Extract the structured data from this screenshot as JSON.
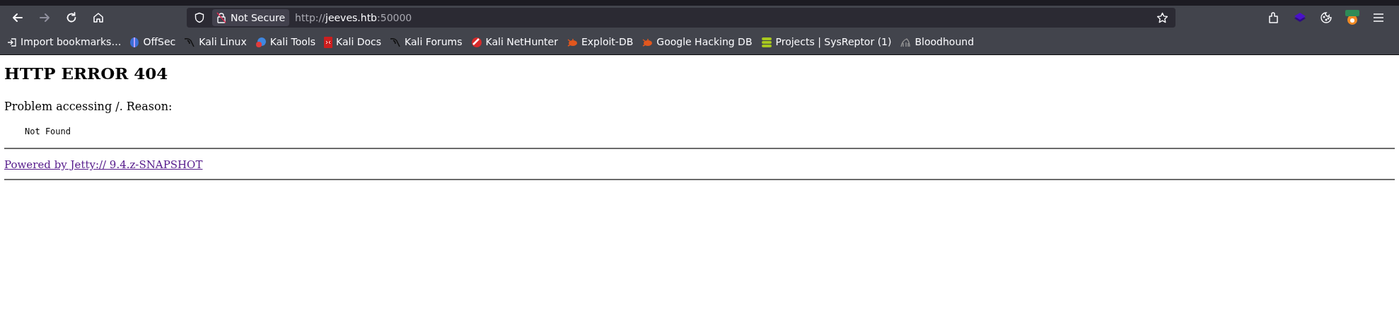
{
  "toolbar": {
    "back": {
      "disabled": false
    },
    "forward": {
      "disabled": true
    },
    "security_label": "Not Secure",
    "url": {
      "scheme": "http://",
      "host": "jeeves.htb",
      "port": ":50000"
    }
  },
  "bookmarks": [
    {
      "label": "Import bookmarks…"
    },
    {
      "label": "OffSec"
    },
    {
      "label": "Kali Linux"
    },
    {
      "label": "Kali Tools"
    },
    {
      "label": "Kali Docs"
    },
    {
      "label": "Kali Forums"
    },
    {
      "label": "Kali NetHunter"
    },
    {
      "label": "Exploit-DB"
    },
    {
      "label": "Google Hacking DB"
    },
    {
      "label": "Projects | SysReptor (1)"
    },
    {
      "label": "Bloodhound"
    }
  ],
  "page": {
    "heading": "HTTP ERROR 404",
    "message": "Problem accessing /. Reason:",
    "reason": "Not Found",
    "footer_link": "Powered by Jetty:// 9.4.z-SNAPSHOT"
  }
}
